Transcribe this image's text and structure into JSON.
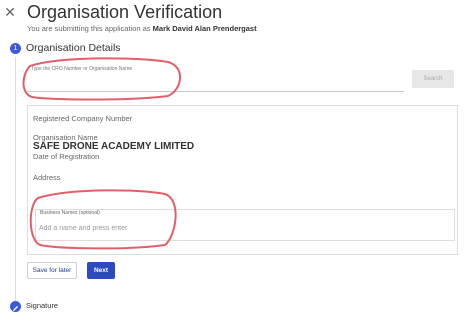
{
  "header": {
    "title": "Organisation Verification",
    "subtitle_prefix": "You are submitting this application as",
    "submitter_name": "Mark David Alan Prendergast"
  },
  "step1": {
    "number": "1",
    "label": "Organisation Details"
  },
  "search": {
    "label": "Type the CRO Number or Organisation Name",
    "button_label": "Search"
  },
  "details": {
    "registered_company_number_label": "Registered Company Number",
    "organisation_name_label": "Organisation Name",
    "organisation_name_value": "SAFE DRONE ACADEMY LIMITED",
    "date_of_registration_label": "Date of Registration",
    "address_label": "Address"
  },
  "business_names": {
    "label": "Business Names (optional)",
    "placeholder": "Add a name and press enter"
  },
  "actions": {
    "save_label": "Save for later",
    "next_label": "Next"
  },
  "step2": {
    "label": "Signature"
  },
  "colors": {
    "accent": "#3b5bd6",
    "next_button": "#2c4bbf",
    "annotation": "#e0606a"
  },
  "icons": {
    "close": "close-icon",
    "signature_step": "pencil-icon"
  }
}
